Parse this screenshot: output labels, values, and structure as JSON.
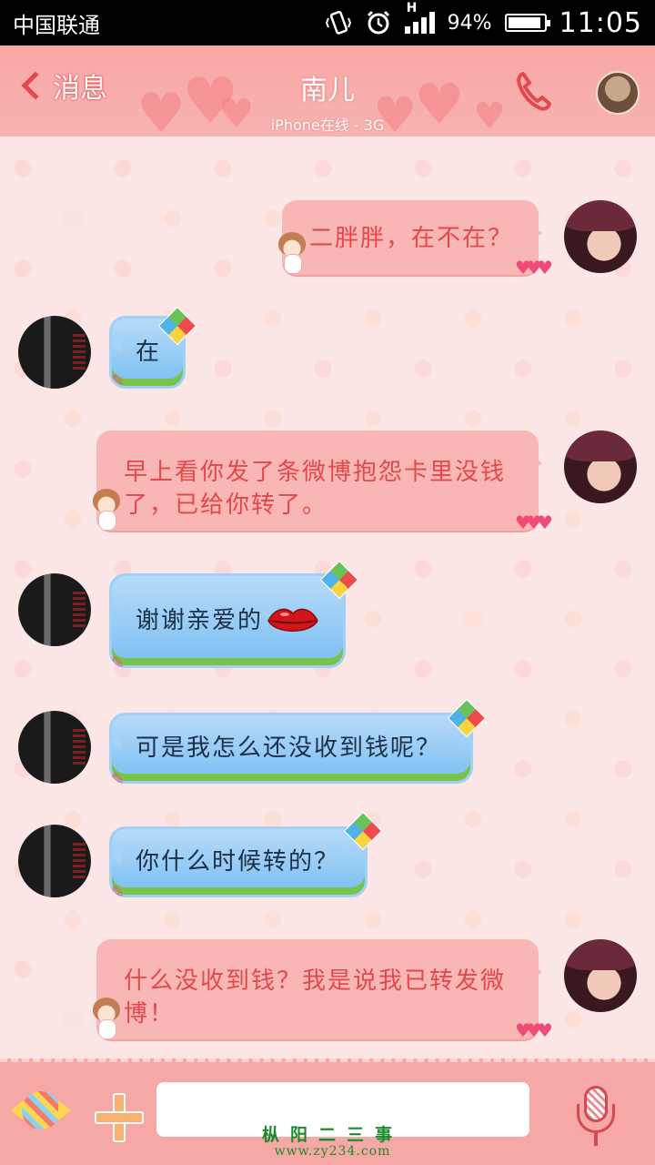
{
  "status_bar": {
    "carrier": "中国联通",
    "battery": "94%",
    "battery_level": 0.94,
    "time": "11:05",
    "network": "H"
  },
  "header": {
    "back_label": "消息",
    "title": "南儿",
    "subtitle": "iPhone在线 - 3G"
  },
  "messages": [
    {
      "side": "out",
      "text": "二胖胖，在不在？"
    },
    {
      "side": "in",
      "text": "在"
    },
    {
      "side": "out",
      "text": "早上看你发了条微博抱怨卡里没钱了，已给你转了。"
    },
    {
      "side": "in",
      "text": "谢谢亲爱的"
    },
    {
      "side": "in",
      "text": "可是我怎么还没收到钱呢？"
    },
    {
      "side": "in",
      "text": "你什么时候转的？"
    },
    {
      "side": "out",
      "text": "什么没收到钱？我是说我已转发微博！"
    }
  ],
  "input": {
    "value": ""
  },
  "watermark": {
    "main": "枞阳二三事",
    "url": "www.zy234.com"
  },
  "colors": {
    "header_bg": "#f8a7a5",
    "outgoing_bubble": "#f8b7b5",
    "outgoing_text": "#e4484b",
    "incoming_bubble": "#7bbff3",
    "incoming_text": "#1c2f46"
  },
  "icons": [
    "back-arrow-icon",
    "phone-icon",
    "candy-icon",
    "plus-icon",
    "microphone-icon",
    "kite-icon",
    "lips-icon"
  ]
}
